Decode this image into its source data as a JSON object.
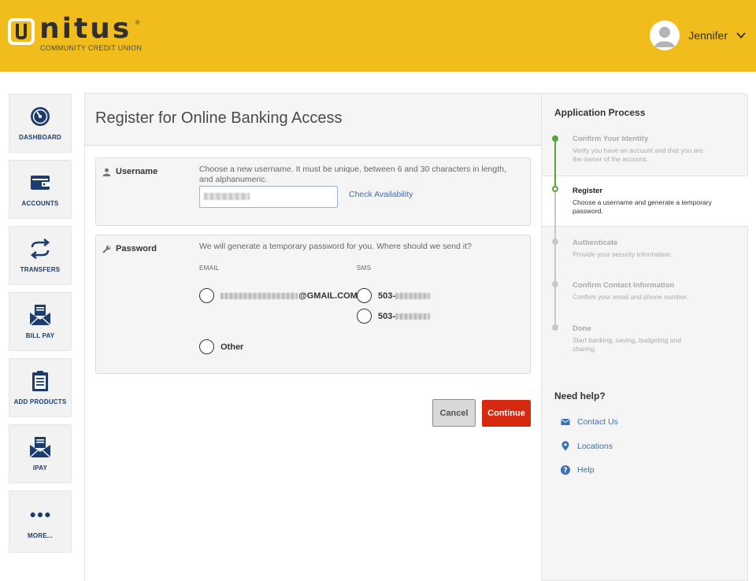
{
  "brand": {
    "name": "nitus",
    "tagline": "COMMUNITY CREDIT UNION",
    "reg_mark": "®",
    "colors": {
      "header": "#f0bd1c",
      "navy": "#1d3c6e",
      "accent_red": "#d7290f",
      "link": "#3b6fb6",
      "progress_green": "#5aa33a"
    }
  },
  "user": {
    "name": "Jennifer",
    "icon": "chevron-down-icon"
  },
  "sidebar": {
    "items": [
      {
        "label": "DASHBOARD",
        "icon": "gauge-icon"
      },
      {
        "label": "ACCOUNTS",
        "icon": "wallet-icon"
      },
      {
        "label": "TRANSFERS",
        "icon": "transfer-arrows-icon"
      },
      {
        "label": "BILL PAY",
        "icon": "envelope-bill-icon"
      },
      {
        "label": "ADD PRODUCTS",
        "icon": "clipboard-icon"
      },
      {
        "label": "IPAY",
        "icon": "envelope-pay-icon"
      },
      {
        "label": "MORE...",
        "icon": "ellipsis-icon"
      }
    ]
  },
  "main": {
    "title": "Register for Online Banking Access",
    "username": {
      "label": "Username",
      "help": "Choose a new username. It must be unique, between 6 and 30 characters in length, and alphanumeric.",
      "value": "",
      "check_link": "Check Availability"
    },
    "password": {
      "label": "Password",
      "help": "We will generate a temporary password for you. Where should we send it?",
      "email_header": "EMAIL",
      "sms_header": "SMS",
      "email_option": "@GMAIL.COM",
      "sms_options": [
        "503-",
        "503-"
      ],
      "other_option": "Other"
    },
    "buttons": {
      "cancel": "Cancel",
      "continue": "Continue"
    }
  },
  "process": {
    "title": "Application Process",
    "steps": [
      {
        "title": "Confirm Your Identity",
        "desc": "Verify you have an account and that you are the owner of the account."
      },
      {
        "title": "Register",
        "desc": "Choose a username and generate a temporary password."
      },
      {
        "title": "Authenticate",
        "desc": "Provide your security information."
      },
      {
        "title": "Confirm Contact Information",
        "desc": "Confirm your email and phone number."
      },
      {
        "title": "Done",
        "desc": "Start banking, saving, budgeting and sharing."
      }
    ]
  },
  "help": {
    "title": "Need help?",
    "links": [
      {
        "label": "Contact Us",
        "icon": "envelope-icon"
      },
      {
        "label": "Locations",
        "icon": "map-pin-icon"
      },
      {
        "label": "Help",
        "icon": "question-circle-icon"
      }
    ]
  }
}
